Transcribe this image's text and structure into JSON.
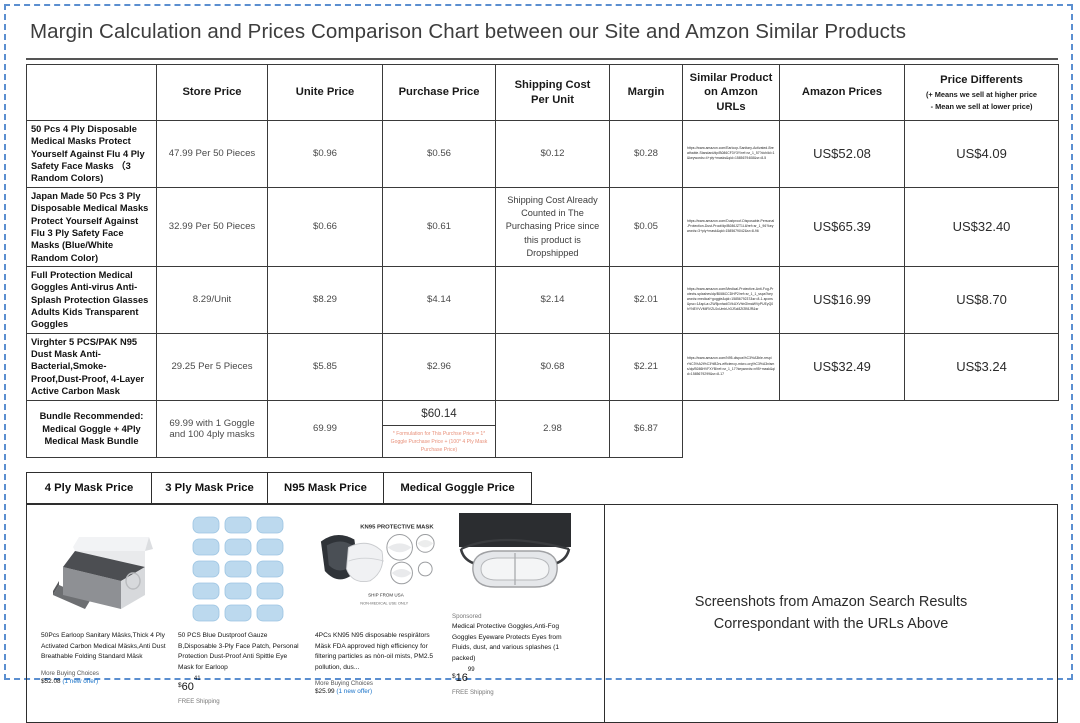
{
  "document": {
    "title": "Margin Calculation and Prices Comparison Chart between our Site and Amzon Similar Products"
  },
  "table": {
    "headers": {
      "name": "",
      "store_price": "Store Price",
      "unite_price": "Unite Price",
      "purchase_price": "Purchase Price",
      "shipping_cost": "Shipping Cost\nPer Unit",
      "shipping_cost_l1": "Shipping Cost",
      "shipping_cost_l2": "Per Unit",
      "margin": "Margin",
      "urls_l1": "Similar Product",
      "urls_l2": "on Amzon",
      "urls_l3": "URLs",
      "amazon_prices": "Amazon Prices",
      "price_diff_main": "Price Differents",
      "price_diff_sub1": "(+ Means we sell at higher price",
      "price_diff_sub2": "-  Mean we sell at lower price)"
    },
    "rows": [
      {
        "name": "50 Pcs 4 Ply Disposable Medical Masks Protect Yourself Against Flu 4 Ply Safety Face Masks （3 Random Colors)",
        "store_price": "47.99 Per 50 Pieces",
        "unite_price": "$0.96",
        "purchase_price": "$0.56",
        "shipping_cost": "$0.12",
        "margin": "$0.28",
        "url": "https://www.amazon.com/Earloop-Sanitary-Activated-Breathable-Standard/dp/B086CF3Y3Y/ref=sr_1_57?dchild=1&keywords=4+ply+masks&qid=1585679408&sr=8-5",
        "amazon_price": "US$52.08",
        "price_difference": "US$4.09"
      },
      {
        "name": "Japan Made 50 Pcs 3 Ply Disposable Medical Masks Protect Yourself Against Flu 3 Ply Safety Face Masks (Blue/White Random Color)",
        "store_price": "32.99 Per 50 Pieces",
        "unite_price": "$0.66",
        "purchase_price": "$0.61",
        "shipping_cost": "Shipping Cost  Already Counted in The Purchasing Price since this product is Dropshipped",
        "margin": "$0.05",
        "url": "https://www.amazon.com/Dustproof-Disposable-Personal-Protection-Dust-Proof/dp/B086JZT1L8/ref=sr_1_96?keywords=3+ply+mask&qid=1585679042&sr=8-96",
        "amazon_price": "US$65.39",
        "price_difference": "US$32.40"
      },
      {
        "name": "Full Protection Medical Goggles Anti-virus Anti-Splash Protection Glasses Adults Kids Transparent Goggles",
        "store_price": "8.29/Unit",
        "unite_price": "$8.29",
        "purchase_price": "$4.14",
        "shipping_cost": "$2.14",
        "margin": "$2.01",
        "url": "https://www.amazon.com/Medical-Protective-Anti-Fog-Protects-splashes/dp/B086CCDHP2/ref=sr_1_1_sspa?keywords=medical+goggle&qid=1585679237&sr=8-1-spons&psc=1&spLa=ZW5jcnlwdGVkUXVhbGlmaWVyPUEyQ0hYNEVVVMiRVZUJcUmbUr3JScl8ZfZfl8JR&sr",
        "amazon_price": "US$16.99",
        "price_difference": "US$8.70"
      },
      {
        "name": "Virghter 5 PCS/PAK N95 Dust Mask Anti-Bacterial,Smoke-Proof,Dust-Proof, 4-Layer Active Carbon Mask",
        "store_price": "29.25 Per 5 Pieces",
        "unite_price": "$5.85",
        "purchase_price": "$2.96",
        "shipping_cost": "$0.68",
        "margin": "$2.21",
        "url": "https://www.amazon.com/N95-dispos%C3%A3ble-respir%C3%A2t%C3%B2rs-efficiency-micro-org%C3%A3nisms/dp/B086HVFXYB/ref=sr_1_17?keywords=n95+mask&qid=1585679299&sr=8-17",
        "amazon_price": "US$32.49",
        "price_difference": "US$3.24"
      },
      {
        "name": "Bundle Recommended: Medical Goggle + 4Ply Medical Mask Bundle",
        "store_price": "69.99 with 1 Goggle and 100 4ply masks",
        "unite_price": "69.99",
        "purchase_price": "$60.14",
        "purchase_note": "* Formulation for This Purchse Price = 1* Goggle Purchase Price + (100* 4 Ply Mask Purchase Price)",
        "shipping_cost": "2.98",
        "margin": "$6.87",
        "url": "",
        "amazon_price": "",
        "price_difference": ""
      }
    ]
  },
  "tabs": [
    {
      "label": "4 Ply Mask Price"
    },
    {
      "label": "3 Ply Mask Price"
    },
    {
      "label": "N95 Mask Price"
    },
    {
      "label": "Medical Goggle Price"
    }
  ],
  "products": [
    {
      "image_name": "carbon-mask-box-image",
      "sponsored": "",
      "title": "50Pcs Earloop Sanitary Mäsks,Thick 4 Ply Activated Carbon Medical Mäsks,Anti Dust Breathable Folding Standard Mäsk",
      "more_buying_choices": "More Buying Choices",
      "price": "$52.08",
      "offer": "(1 new offer)",
      "big_price_currency": "",
      "big_price_main": "",
      "big_price_sup": "",
      "free_shipping": ""
    },
    {
      "image_name": "blue-masks-grid-image",
      "sponsored": "",
      "title": "50 PCS Blue Dustproof Gauze B,Disposable 3-Ply Face Patch, Personal Protection Dust-Proof Anti Spittle Eye Mask for Earloop",
      "more_buying_choices": "",
      "price": "",
      "offer": "",
      "big_price_currency": "$",
      "big_price_main": "60",
      "big_price_sup": "41",
      "free_shipping": "FREE Shipping"
    },
    {
      "image_name": "n95-respirator-model-image",
      "sponsored": "",
      "title": "4PCs KN95 N95 disposable respirätors Mäsk FDA approved high efficiency for filtering particles as nòn-oil mists, PM2.5 pollution, dus...",
      "more_buying_choices": "More Buying Choices",
      "price": "$25.99",
      "offer": "(1 new offer)",
      "big_price_currency": "",
      "big_price_main": "",
      "big_price_sup": "",
      "free_shipping": ""
    },
    {
      "image_name": "protective-goggles-image",
      "sponsored": "Sponsored",
      "title": "Medical Protective Goggles,Anti-Fog Goggles Eyeware Protects Eyes from Fluids, dust, and various splashes (1 packed)",
      "more_buying_choices": "",
      "price": "",
      "offer": "",
      "big_price_currency": "$",
      "big_price_main": "16",
      "big_price_sup": "99",
      "free_shipping": "FREE Shipping"
    }
  ],
  "right_panel": {
    "line1": "Screenshots from Amazon Search Results",
    "line2": "Correspondant with the URLs Above"
  },
  "colors": {
    "page_border": "#5b8fd0",
    "table_border": "#3a3a3a",
    "note_text": "#e8907a",
    "link_blue": "#1a73c8"
  }
}
